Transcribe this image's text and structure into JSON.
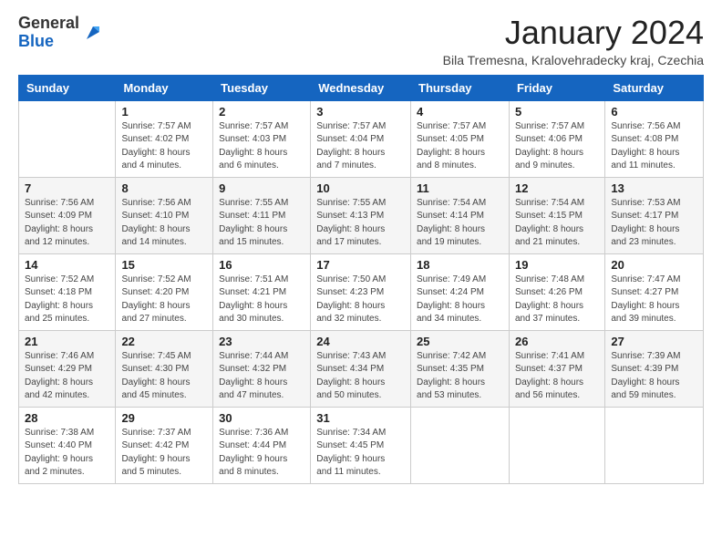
{
  "logo": {
    "general": "General",
    "blue": "Blue"
  },
  "title": "January 2024",
  "subtitle": "Bila Tremesna, Kralovehradecky kraj, Czechia",
  "days_of_week": [
    "Sunday",
    "Monday",
    "Tuesday",
    "Wednesday",
    "Thursday",
    "Friday",
    "Saturday"
  ],
  "weeks": [
    [
      {
        "num": "",
        "info": ""
      },
      {
        "num": "1",
        "info": "Sunrise: 7:57 AM\nSunset: 4:02 PM\nDaylight: 8 hours\nand 4 minutes."
      },
      {
        "num": "2",
        "info": "Sunrise: 7:57 AM\nSunset: 4:03 PM\nDaylight: 8 hours\nand 6 minutes."
      },
      {
        "num": "3",
        "info": "Sunrise: 7:57 AM\nSunset: 4:04 PM\nDaylight: 8 hours\nand 7 minutes."
      },
      {
        "num": "4",
        "info": "Sunrise: 7:57 AM\nSunset: 4:05 PM\nDaylight: 8 hours\nand 8 minutes."
      },
      {
        "num": "5",
        "info": "Sunrise: 7:57 AM\nSunset: 4:06 PM\nDaylight: 8 hours\nand 9 minutes."
      },
      {
        "num": "6",
        "info": "Sunrise: 7:56 AM\nSunset: 4:08 PM\nDaylight: 8 hours\nand 11 minutes."
      }
    ],
    [
      {
        "num": "7",
        "info": "Sunrise: 7:56 AM\nSunset: 4:09 PM\nDaylight: 8 hours\nand 12 minutes."
      },
      {
        "num": "8",
        "info": "Sunrise: 7:56 AM\nSunset: 4:10 PM\nDaylight: 8 hours\nand 14 minutes."
      },
      {
        "num": "9",
        "info": "Sunrise: 7:55 AM\nSunset: 4:11 PM\nDaylight: 8 hours\nand 15 minutes."
      },
      {
        "num": "10",
        "info": "Sunrise: 7:55 AM\nSunset: 4:13 PM\nDaylight: 8 hours\nand 17 minutes."
      },
      {
        "num": "11",
        "info": "Sunrise: 7:54 AM\nSunset: 4:14 PM\nDaylight: 8 hours\nand 19 minutes."
      },
      {
        "num": "12",
        "info": "Sunrise: 7:54 AM\nSunset: 4:15 PM\nDaylight: 8 hours\nand 21 minutes."
      },
      {
        "num": "13",
        "info": "Sunrise: 7:53 AM\nSunset: 4:17 PM\nDaylight: 8 hours\nand 23 minutes."
      }
    ],
    [
      {
        "num": "14",
        "info": "Sunrise: 7:52 AM\nSunset: 4:18 PM\nDaylight: 8 hours\nand 25 minutes."
      },
      {
        "num": "15",
        "info": "Sunrise: 7:52 AM\nSunset: 4:20 PM\nDaylight: 8 hours\nand 27 minutes."
      },
      {
        "num": "16",
        "info": "Sunrise: 7:51 AM\nSunset: 4:21 PM\nDaylight: 8 hours\nand 30 minutes."
      },
      {
        "num": "17",
        "info": "Sunrise: 7:50 AM\nSunset: 4:23 PM\nDaylight: 8 hours\nand 32 minutes."
      },
      {
        "num": "18",
        "info": "Sunrise: 7:49 AM\nSunset: 4:24 PM\nDaylight: 8 hours\nand 34 minutes."
      },
      {
        "num": "19",
        "info": "Sunrise: 7:48 AM\nSunset: 4:26 PM\nDaylight: 8 hours\nand 37 minutes."
      },
      {
        "num": "20",
        "info": "Sunrise: 7:47 AM\nSunset: 4:27 PM\nDaylight: 8 hours\nand 39 minutes."
      }
    ],
    [
      {
        "num": "21",
        "info": "Sunrise: 7:46 AM\nSunset: 4:29 PM\nDaylight: 8 hours\nand 42 minutes."
      },
      {
        "num": "22",
        "info": "Sunrise: 7:45 AM\nSunset: 4:30 PM\nDaylight: 8 hours\nand 45 minutes."
      },
      {
        "num": "23",
        "info": "Sunrise: 7:44 AM\nSunset: 4:32 PM\nDaylight: 8 hours\nand 47 minutes."
      },
      {
        "num": "24",
        "info": "Sunrise: 7:43 AM\nSunset: 4:34 PM\nDaylight: 8 hours\nand 50 minutes."
      },
      {
        "num": "25",
        "info": "Sunrise: 7:42 AM\nSunset: 4:35 PM\nDaylight: 8 hours\nand 53 minutes."
      },
      {
        "num": "26",
        "info": "Sunrise: 7:41 AM\nSunset: 4:37 PM\nDaylight: 8 hours\nand 56 minutes."
      },
      {
        "num": "27",
        "info": "Sunrise: 7:39 AM\nSunset: 4:39 PM\nDaylight: 8 hours\nand 59 minutes."
      }
    ],
    [
      {
        "num": "28",
        "info": "Sunrise: 7:38 AM\nSunset: 4:40 PM\nDaylight: 9 hours\nand 2 minutes."
      },
      {
        "num": "29",
        "info": "Sunrise: 7:37 AM\nSunset: 4:42 PM\nDaylight: 9 hours\nand 5 minutes."
      },
      {
        "num": "30",
        "info": "Sunrise: 7:36 AM\nSunset: 4:44 PM\nDaylight: 9 hours\nand 8 minutes."
      },
      {
        "num": "31",
        "info": "Sunrise: 7:34 AM\nSunset: 4:45 PM\nDaylight: 9 hours\nand 11 minutes."
      },
      {
        "num": "",
        "info": ""
      },
      {
        "num": "",
        "info": ""
      },
      {
        "num": "",
        "info": ""
      }
    ]
  ]
}
